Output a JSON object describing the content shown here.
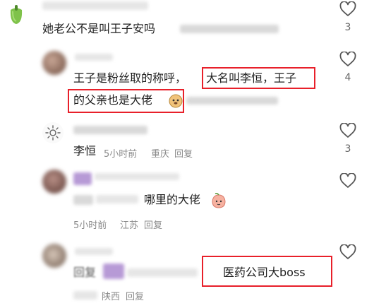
{
  "comments": [
    {
      "text": "她老公不是叫王子安吗",
      "like_count": "3"
    },
    {
      "text_line1_a": "王子是粉丝取的称呼，",
      "text_line1_b": "大名叫李恒，王子",
      "text_line2_a": "的父亲也是大佬",
      "like_count": "4"
    },
    {
      "text": "李恒",
      "time": "5小时前",
      "location": "重庆",
      "reply": "回复",
      "like_count": "3"
    },
    {
      "text": "哪里的大佬",
      "time": "5小时前",
      "location": "江苏",
      "reply": "回复"
    },
    {
      "prefix": "回复",
      "text": "医药公司大boss",
      "location": "陕西",
      "reply": "回复"
    }
  ],
  "colors": {
    "highlight": "#e8202a",
    "meta": "#8a8a8a"
  },
  "icons": [
    "heart-outline-icon",
    "doge-emoji",
    "peach-emoji",
    "sun-icon"
  ]
}
